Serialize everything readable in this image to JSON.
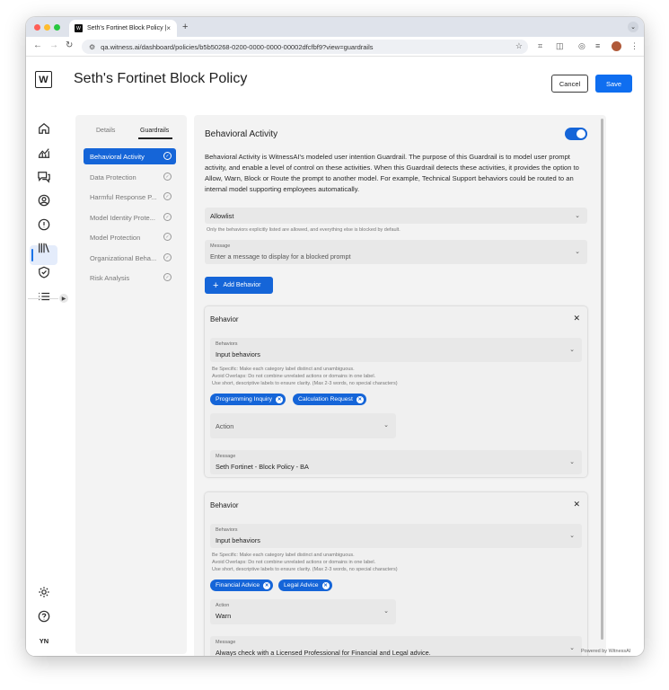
{
  "browser": {
    "tab_title": "Seth's Fortinet Block Policy |",
    "favicon_text": "W",
    "tab_close": "×",
    "new_tab": "+",
    "url": "qa.witness.ai/dashboard/policies/b5b50268-0200-0000-0000-00002dfcfbf9?view=guardrails",
    "traffic_colors": [
      "#ff5f57",
      "#febc2e",
      "#28c840"
    ]
  },
  "app": {
    "logo": "W",
    "page_title": "Seth's Fortinet Block Policy",
    "cancel_label": "Cancel",
    "save_label": "Save",
    "user_initials": "YN",
    "footer": "Powered by WitnessAI",
    "accent_color": "#1565d8",
    "rail_icons": [
      "home-icon",
      "analytics-icon",
      "conversations-icon",
      "user-icon",
      "alert-icon",
      "library-icon",
      "shield-check-icon",
      "list-icon",
      "settings-icon",
      "help-icon"
    ]
  },
  "left_panel": {
    "tabs": [
      {
        "label": "Details",
        "active": false
      },
      {
        "label": "Guardrails",
        "active": true
      }
    ],
    "items": [
      {
        "label": "Behavioral Activity",
        "active": true
      },
      {
        "label": "Data Protection",
        "active": false
      },
      {
        "label": "Harmful Response P...",
        "active": false
      },
      {
        "label": "Model Identity Prote...",
        "active": false
      },
      {
        "label": "Model Protection",
        "active": false
      },
      {
        "label": "Organizational Beha...",
        "active": false
      },
      {
        "label": "Risk Analysis",
        "active": false
      }
    ]
  },
  "main": {
    "title": "Behavioral Activity",
    "toggle_on": true,
    "description": "Behavioral Activity is WitnessAI's modeled user intention Guardrail. The purpose of this Guardrail is to model user prompt activity, and enable a level of control on these activities. When this Guardrail detects these activities, it provides the option to Allow, Warn, Block or Route the prompt to another model. For example, Technical Support behaviors could be routed to an internal model supporting employees automatically.",
    "mode_select": "Allowlist",
    "mode_hint": "Only the behaviors explicitly listed are allowed, and everything else is blocked by default.",
    "message_label": "Message",
    "message_placeholder": "Enter a message to display for a blocked prompt",
    "add_behavior_label": "Add Behavior",
    "behaviors": [
      {
        "title": "Behavior",
        "behaviors_label": "Behaviors",
        "behaviors_placeholder": "Input behaviors",
        "hint_1": "Be Specific: Make each category label distinct and unambiguous.",
        "hint_2": "Avoid Overlaps: Do not combine unrelated actions or domains in one label.",
        "hint_3": "Use short, descriptive labels to ensure clarity. (Max 2-3 words, no special characters)",
        "chips": [
          "Programming Inquiry",
          "Calculation Request"
        ],
        "action_label": "Action",
        "action_value": "",
        "message_label": "Message",
        "message_value": "Seth Fortinet - Block Policy - BA"
      },
      {
        "title": "Behavior",
        "behaviors_label": "Behaviors",
        "behaviors_placeholder": "Input behaviors",
        "hint_1": "Be Specific: Make each category label distinct and unambiguous.",
        "hint_2": "Avoid Overlaps: Do not combine unrelated actions or domains in one label.",
        "hint_3": "Use short, descriptive labels to ensure clarity. (Max 2-3 words, no special characters)",
        "chips": [
          "Financial Advice",
          "Legal Advice"
        ],
        "action_label": "Action",
        "action_value": "Warn",
        "message_label": "Message",
        "message_value": "Always check with a Licensed Professional for Financial and Legal advice."
      }
    ]
  }
}
